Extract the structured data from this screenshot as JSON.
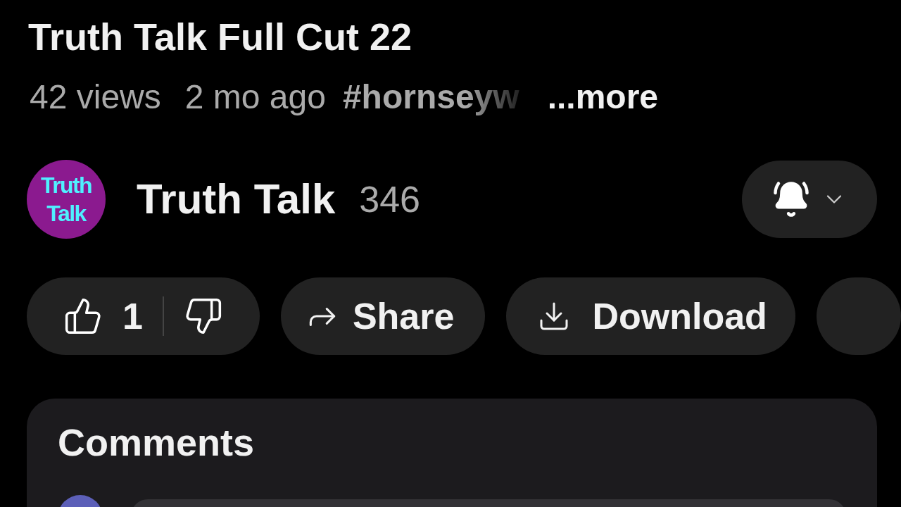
{
  "video": {
    "title": "Truth Talk Full Cut 22",
    "views": "42 views",
    "age": "2 mo ago",
    "hashtag": "#hornseyw",
    "more": "...more"
  },
  "channel": {
    "avatar_text": [
      "Truth",
      "Talk"
    ],
    "name": "Truth Talk",
    "subscribers": "346",
    "bell_ringing": true
  },
  "actions": [
    {
      "kind": "like",
      "label": "1"
    },
    {
      "kind": "share",
      "label": "Share"
    },
    {
      "kind": "download",
      "label": "Download"
    },
    {
      "kind": "more"
    }
  ],
  "comments": {
    "title": "Comments"
  }
}
